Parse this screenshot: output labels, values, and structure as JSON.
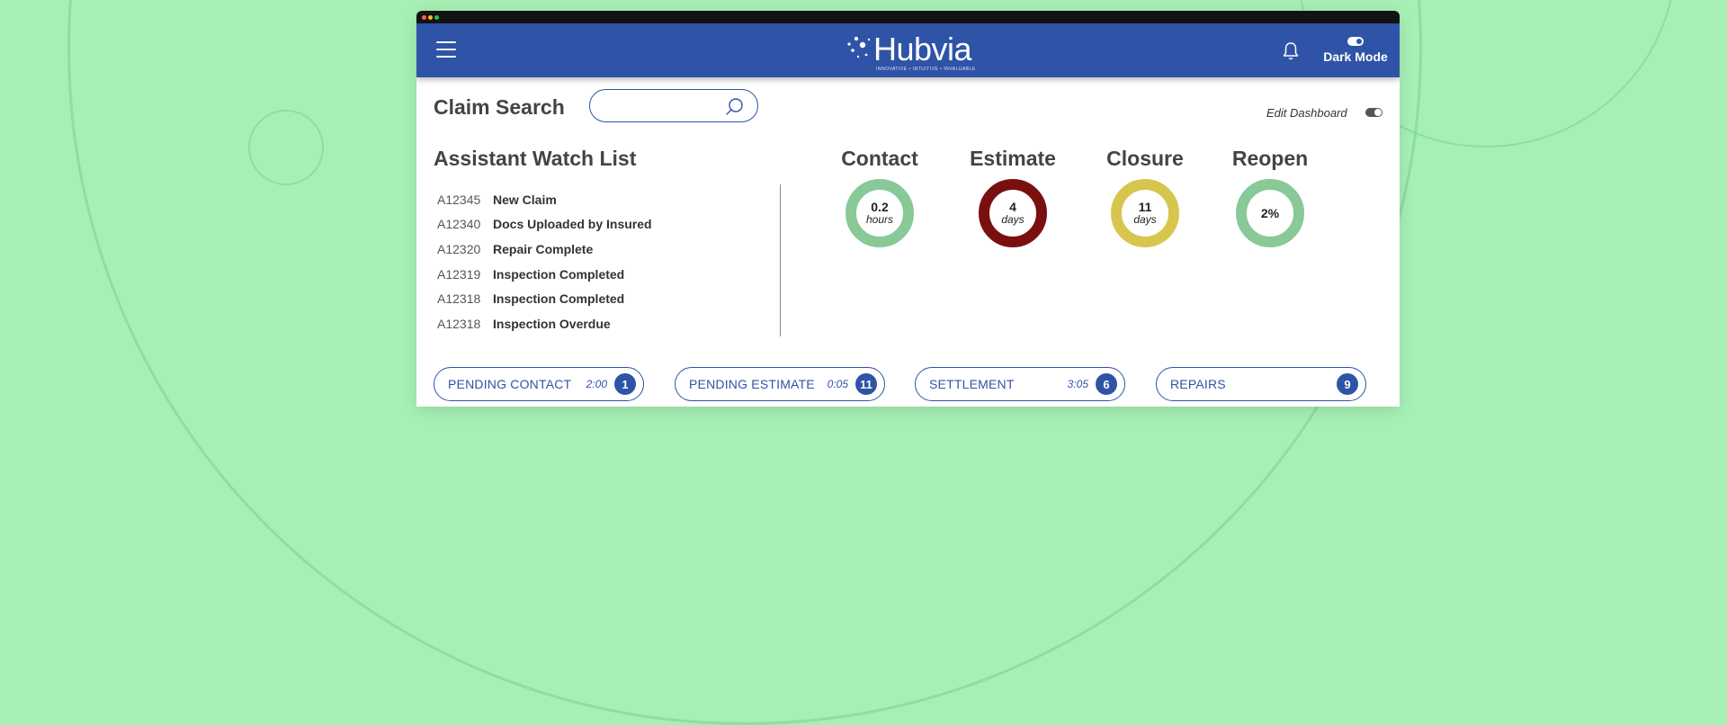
{
  "brand": {
    "name": "Hubvia",
    "tagline": "INNOVATIVE • INTUITIVE • INVALUABLE",
    "color": "#2f53a6"
  },
  "header": {
    "menu_icon": "hamburger-icon",
    "bell_icon": "bell-icon",
    "dark_mode_label": "Dark Mode"
  },
  "claim_search": {
    "title": "Claim Search",
    "value": "",
    "placeholder": ""
  },
  "edit_dashboard": {
    "label": "Edit Dashboard",
    "enabled": true
  },
  "watch_list": {
    "title": "Assistant Watch List",
    "items": [
      {
        "id": "A12345",
        "status": "New Claim"
      },
      {
        "id": "A12340",
        "status": "Docs Uploaded by Insured"
      },
      {
        "id": "A12320",
        "status": "Repair Complete"
      },
      {
        "id": "A12319",
        "status": "Inspection Completed"
      },
      {
        "id": "A12318",
        "status": "Inspection Completed"
      },
      {
        "id": "A12318",
        "status": "Inspection Overdue"
      }
    ]
  },
  "metrics": [
    {
      "title": "Contact",
      "value": "0.2",
      "unit": "hours",
      "color": "#88c997"
    },
    {
      "title": "Estimate",
      "value": "4",
      "unit": "days",
      "color": "#7a0f0f"
    },
    {
      "title": "Closure",
      "value": "11",
      "unit": "days",
      "color": "#d6c64d"
    },
    {
      "title": "Reopen",
      "value": "2%",
      "unit": "",
      "color": "#88c997"
    }
  ],
  "queues": [
    {
      "label": "PENDING CONTACT",
      "time": "2:00",
      "count": "1"
    },
    {
      "label": "PENDING ESTIMATE",
      "time": "0:05",
      "count": "11"
    },
    {
      "label": "SETTLEMENT",
      "time": "3:05",
      "count": "6"
    },
    {
      "label": "REPAIRS",
      "time": "",
      "count": "9"
    }
  ]
}
